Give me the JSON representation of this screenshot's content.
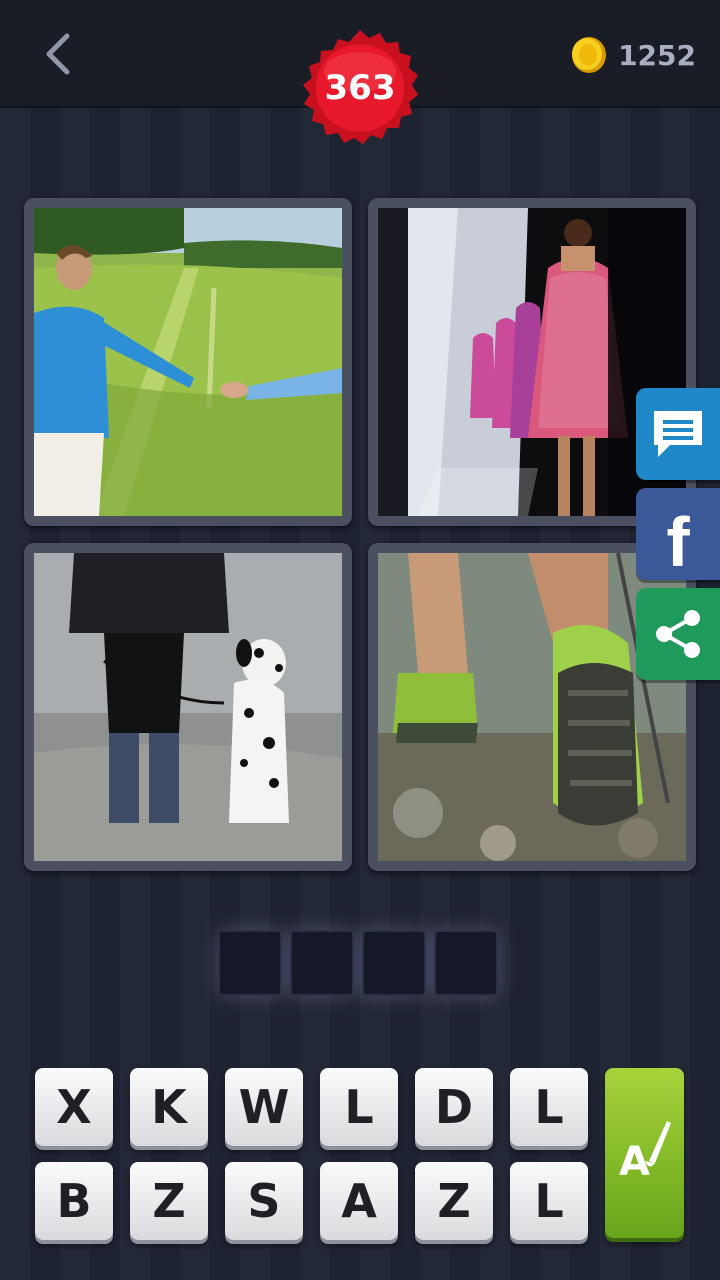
{
  "header": {
    "level": "363",
    "coins": "1252"
  },
  "icons": {
    "back": "chevron-left-icon",
    "coin": "coin-icon",
    "chat": "chat-bubble-icon",
    "facebook": "facebook-icon",
    "share": "share-icon",
    "hint": "brush-letter-icon"
  },
  "colors": {
    "badge": "#e0142a",
    "coin": "#f4c20d",
    "chat_button": "#1e88c8",
    "facebook_button": "#3b5998",
    "share_button": "#1f9a5b",
    "hint_button": "#7db52a"
  },
  "side_buttons": {
    "facebook_glyph": "f"
  },
  "puzzle": {
    "answer_length": 4,
    "letters_row1": [
      "X",
      "K",
      "W",
      "L",
      "D",
      "L"
    ],
    "letters_row2": [
      "B",
      "Z",
      "S",
      "A",
      "Z",
      "L"
    ]
  }
}
